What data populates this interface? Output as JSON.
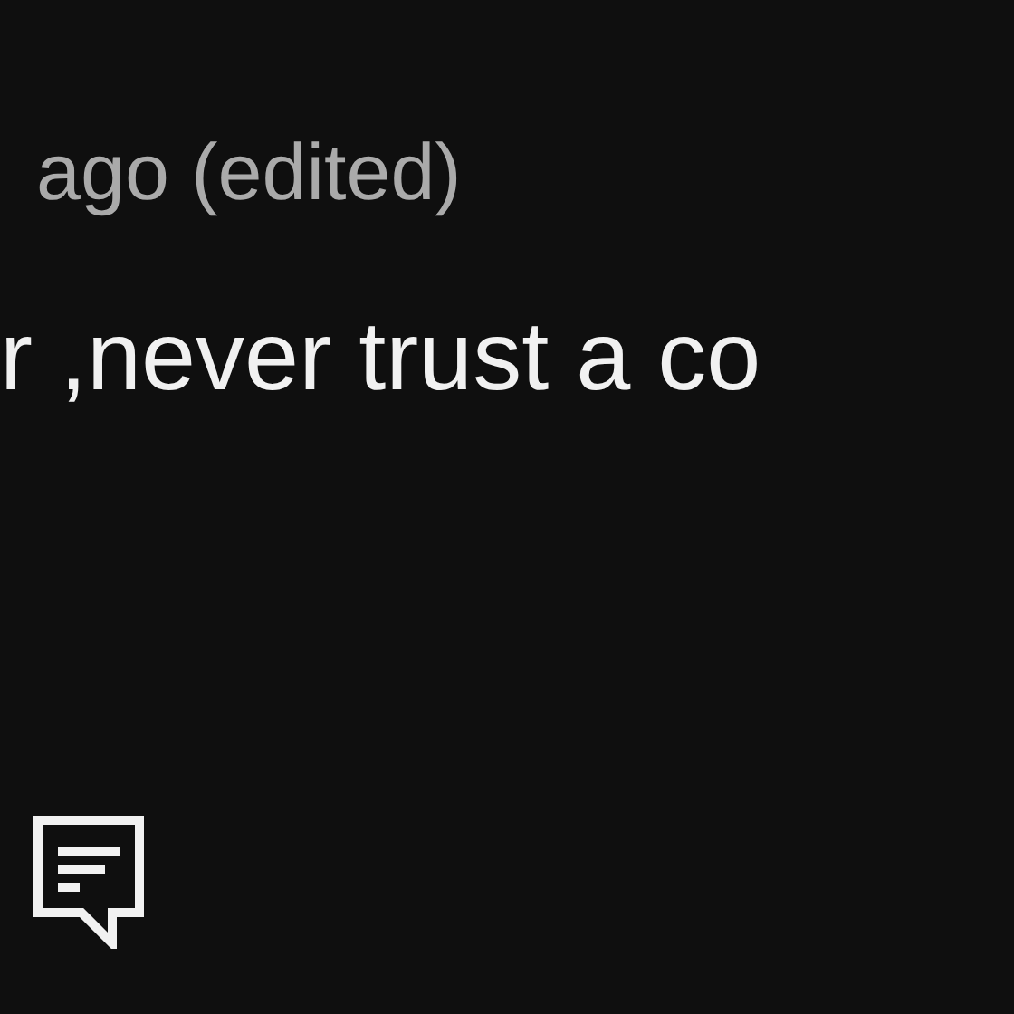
{
  "comment": {
    "meta": "ago (edited)",
    "text": "r ,never trust a co"
  }
}
